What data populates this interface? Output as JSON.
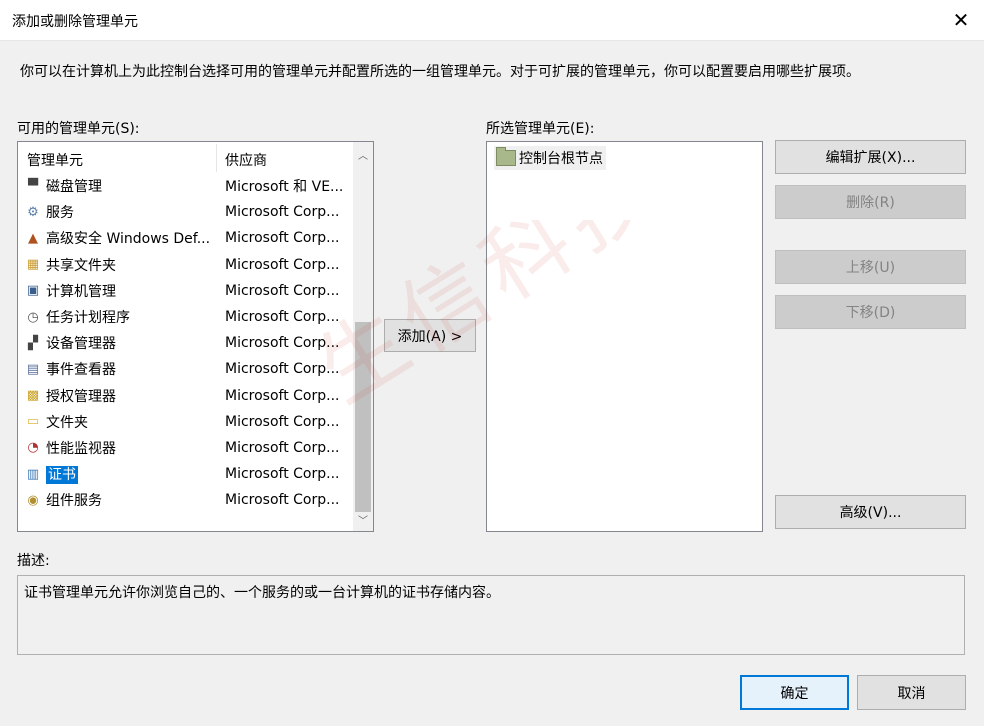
{
  "window": {
    "title": "添加或删除管理单元",
    "close_glyph": "✕"
  },
  "intro_text": "你可以在计算机上为此控制台选择可用的管理单元并配置所选的一组管理单元。对于可扩展的管理单元，你可以配置要启用哪些扩展项。",
  "available": {
    "label": "可用的管理单元(S):",
    "columns": [
      "管理单元",
      "供应商"
    ],
    "items": [
      {
        "name": "磁盘管理",
        "vendor": "Microsoft 和 VE...",
        "icon": "disk-management-icon",
        "glyph": "▀"
      },
      {
        "name": "服务",
        "vendor": "Microsoft Corp...",
        "icon": "services-gear-icon",
        "glyph": "⚙"
      },
      {
        "name": "高级安全 Windows Def...",
        "vendor": "Microsoft Corp...",
        "icon": "firewall-icon",
        "glyph": "▲"
      },
      {
        "name": "共享文件夹",
        "vendor": "Microsoft Corp...",
        "icon": "shared-folder-icon",
        "glyph": "▦"
      },
      {
        "name": "计算机管理",
        "vendor": "Microsoft Corp...",
        "icon": "computer-management-icon",
        "glyph": "▣"
      },
      {
        "name": "任务计划程序",
        "vendor": "Microsoft Corp...",
        "icon": "clock-icon",
        "glyph": "◷"
      },
      {
        "name": "设备管理器",
        "vendor": "Microsoft Corp...",
        "icon": "device-manager-icon",
        "glyph": "▞"
      },
      {
        "name": "事件查看器",
        "vendor": "Microsoft Corp...",
        "icon": "event-viewer-icon",
        "glyph": "▤"
      },
      {
        "name": "授权管理器",
        "vendor": "Microsoft Corp...",
        "icon": "authorization-manager-icon",
        "glyph": "▩"
      },
      {
        "name": "文件夹",
        "vendor": "Microsoft Corp...",
        "icon": "folder-icon",
        "glyph": "▭"
      },
      {
        "name": "性能监视器",
        "vendor": "Microsoft Corp...",
        "icon": "performance-monitor-icon",
        "glyph": "◔"
      },
      {
        "name": "证书",
        "vendor": "Microsoft Corp...",
        "icon": "certificate-icon",
        "glyph": "▥",
        "selected": true
      },
      {
        "name": "组件服务",
        "vendor": "Microsoft Corp...",
        "icon": "component-services-icon",
        "glyph": "◉"
      }
    ],
    "scroll_up_glyph": "︿",
    "scroll_down_glyph": "﹀"
  },
  "add_button": "添加(A) >",
  "selected": {
    "label": "所选管理单元(E):",
    "root_node": "控制台根节点"
  },
  "side_buttons": {
    "edit_extensions": "编辑扩展(X)...",
    "remove": "删除(R)",
    "move_up": "上移(U)",
    "move_down": "下移(D)",
    "advanced": "高级(V)..."
  },
  "description": {
    "label": "描述:",
    "text": "证书管理单元允许你浏览自己的、一个服务的或一台计算机的证书存储内容。"
  },
  "footer": {
    "ok": "确定",
    "cancel": "取消"
  },
  "watermark": "生信科技",
  "colors": {
    "selection": "#0078d7",
    "primary_border": "#0078d7"
  }
}
